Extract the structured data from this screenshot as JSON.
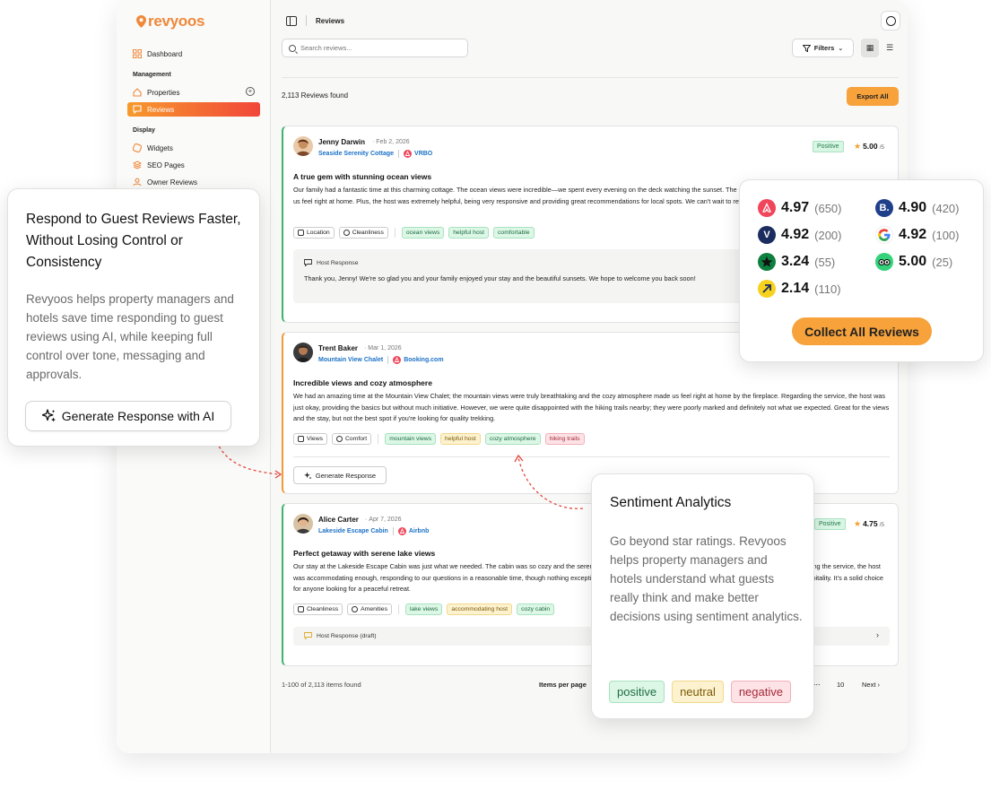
{
  "brand": {
    "name": "revyoos",
    "accent": "#f0883a"
  },
  "sidebar": {
    "dashboard": "Dashboard",
    "management_label": "Management",
    "properties": "Properties",
    "reviews": "Reviews",
    "display_label": "Display",
    "widgets": "Widgets",
    "seo_pages": "SEO Pages",
    "owner_reviews": "Owner Reviews"
  },
  "topbar": {
    "title": "Reviews"
  },
  "search": {
    "placeholder": "Search reviews..."
  },
  "toolbar": {
    "filters": "Filters",
    "export": "Export All"
  },
  "results": {
    "count": "2,113 Reviews found"
  },
  "reviews": [
    {
      "name": "Jenny Darwin",
      "date": "Feb 2, 2026",
      "property": "Seaside Serenity Cottage",
      "channel": "VRBO",
      "sentiment": "Positive",
      "score": "5.00",
      "score_of": "/5",
      "title": "A true gem with stunning ocean views",
      "body": "Our family had a fantastic time at this charming cottage. The ocean views were incredible—we spent every evening on the deck watching the sunset. The cottage was comfortable and well-equipped, making us feel right at home. Plus, the host was extremely helpful, being very responsive and providing great recommendations for local spots. We can't wait to return!",
      "categories": [
        "Location",
        "Cleanliness"
      ],
      "tags": [
        "ocean views",
        "helpful host",
        "comfortable"
      ],
      "host_label": "Host Response",
      "host_text": "Thank you, Jenny! We're so glad you and your family enjoyed your stay and the beautiful sunsets. We hope to welcome you back soon!"
    },
    {
      "name": "Trent Baker",
      "date": "Mar 1, 2026",
      "property": "Mountain View Chalet",
      "channel": "Booking.com",
      "title": "Incredible views and cozy atmosphere",
      "body": "We had an amazing time at the Mountain View Chalet; the mountain views were truly breathtaking and the cozy atmosphere made us feel right at home by the fireplace. Regarding the service, the host was just okay, providing the basics but without much initiative. However, we were quite disappointed with the hiking trails nearby; they were poorly marked and definitely not what we expected. Great for the views and the stay, but not the best spot if you're looking for quality trekking.",
      "categories": [
        "Views",
        "Comfort"
      ],
      "tags": [
        "mountain views",
        "helpful host",
        "cozy atmosphere",
        "hiking trails"
      ],
      "generate": "Generate Response"
    },
    {
      "name": "Alice Carter",
      "date": "Apr 7, 2026",
      "property": "Lakeside Escape Cabin",
      "channel": "Airbnb",
      "sentiment": "Positive",
      "score": "4.75",
      "score_of": "/5",
      "title": "Perfect getaway with serene lake views",
      "body": "Our stay at the Lakeside Escape Cabin was just what we needed. The cabin was so cozy and the serene lake views from the porch were absolutely the highlight of the trip. Regarding the service, the host was accommodating enough, responding to our questions in a reasonable time, though nothing exceptional. Overall the experience overall was more about the setting than the hospitality. It's a solid choice for anyone looking for a peaceful retreat.",
      "categories": [
        "Cleanliness",
        "Amenities"
      ],
      "tags": [
        "lake views",
        "accommodating host",
        "cozy cabin"
      ],
      "host_label": "Host Response (draft)"
    }
  ],
  "footer": {
    "range": "1-100 of 2,113 items found",
    "ipp": "Items per page",
    "ellipsis": "...",
    "last_page": "10",
    "next": "Next"
  },
  "callout_ai": {
    "title": "Respond to Guest Reviews Faster, Without Losing Control or Consistency",
    "body": "Revyoos helps property managers and hotels save time responding to guest reviews using AI, while keeping full control over tone, messaging and approvals.",
    "button": "Generate Response with AI"
  },
  "ratings": {
    "items": [
      {
        "platform": "airbnb",
        "value": "4.97",
        "count": "(650)",
        "color": "#f0455a"
      },
      {
        "platform": "booking",
        "value": "4.90",
        "count": "(420)",
        "color": "#1f3f8a"
      },
      {
        "platform": "vrbo",
        "value": "4.92",
        "count": "(200)",
        "color": "#1b2d5e"
      },
      {
        "platform": "google",
        "value": "4.92",
        "count": "(100)",
        "color": "#ffffff"
      },
      {
        "platform": "trustpilot",
        "value": "3.24",
        "count": "(55)",
        "color": "#0d7f3f"
      },
      {
        "platform": "tripadvisor",
        "value": "5.00",
        "count": "(25)",
        "color": "#34d27a"
      },
      {
        "platform": "expedia",
        "value": "2.14",
        "count": "(110)",
        "color": "#f7d21c"
      }
    ],
    "button": "Collect All Reviews"
  },
  "callout_sentiment": {
    "title": "Sentiment Analytics",
    "body": "Go beyond star ratings. Revyoos helps property managers and hotels understand what guests really think and make better decisions using sentiment analytics.",
    "tags": [
      "positive",
      "neutral",
      "negative"
    ]
  }
}
